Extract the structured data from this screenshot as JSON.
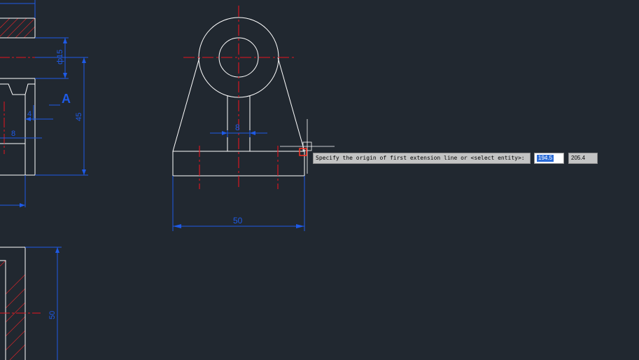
{
  "command_prompt": {
    "text": "Specify the origin of first extension line or <select entity>:",
    "x_value": "194.5",
    "y_value": "205.4"
  },
  "dimensions": {
    "d50_bottom": "50",
    "d8_slot": "8",
    "left_phi15": "ф15",
    "left_45": "45",
    "left_4": "4",
    "left_8": "8",
    "left_view_A": "A",
    "left_50": "50"
  },
  "colors": {
    "background": "#212830",
    "geometry": "#ffffff",
    "dimension": "#1e5ae6",
    "centerline": "#e6141e",
    "hatch": "#c8262c",
    "osnap_marker": "#ff3322"
  }
}
